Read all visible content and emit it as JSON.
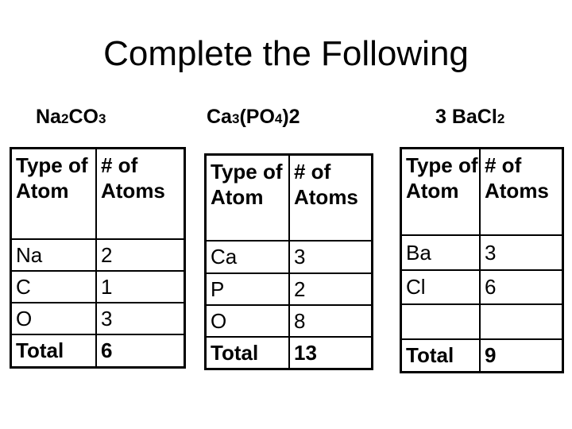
{
  "title": "Complete the Following",
  "headers": {
    "type_of_atom": "Type of Atom",
    "num_atoms": "# of Atoms"
  },
  "total_label": "Total",
  "compounds": [
    {
      "formula_parts": [
        {
          "text": "Na",
          "sub": false
        },
        {
          "text": "2",
          "sub": true
        },
        {
          "text": "CO",
          "sub": false
        },
        {
          "text": "3",
          "sub": true
        }
      ],
      "rows": [
        {
          "atom": "Na",
          "count": "2"
        },
        {
          "atom": "C",
          "count": "1"
        },
        {
          "atom": "O",
          "count": "3"
        }
      ],
      "total": "6"
    },
    {
      "formula_parts": [
        {
          "text": "Ca",
          "sub": false
        },
        {
          "text": "3",
          "sub": true
        },
        {
          "text": "(PO",
          "sub": false
        },
        {
          "text": "4",
          "sub": true
        },
        {
          "text": ")2",
          "sub": false
        }
      ],
      "rows": [
        {
          "atom": "Ca",
          "count": "3"
        },
        {
          "atom": "P",
          "count": "2"
        },
        {
          "atom": "O",
          "count": "8"
        }
      ],
      "total": "13"
    },
    {
      "formula_parts": [
        {
          "text": "3 BaCl",
          "sub": false
        },
        {
          "text": "2",
          "sub": true
        }
      ],
      "rows": [
        {
          "atom": "Ba",
          "count": "3"
        },
        {
          "atom": "Cl",
          "count": "6"
        },
        {
          "atom": "",
          "count": ""
        }
      ],
      "total": "9"
    }
  ]
}
